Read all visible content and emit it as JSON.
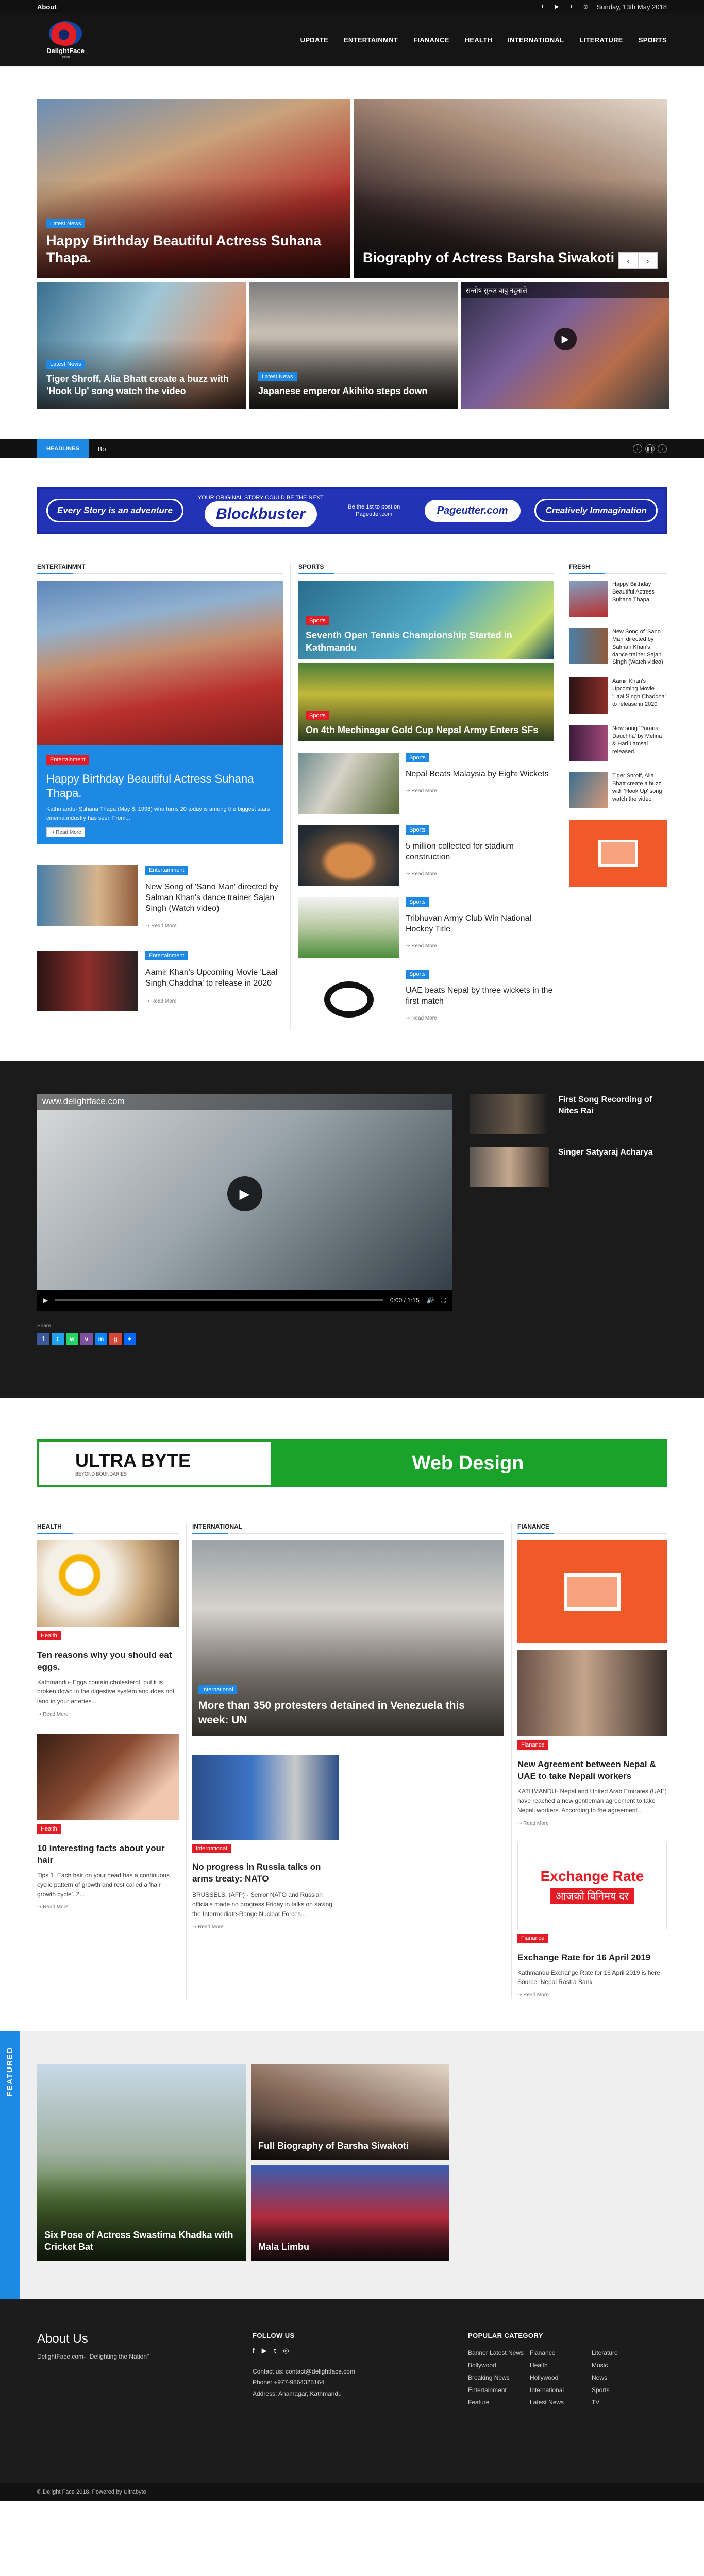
{
  "topbar": {
    "about": "About",
    "date": "Sunday, 13th May 2018"
  },
  "header": {
    "logo_text": "DelightFace",
    "logo_sub": ".com",
    "nav": [
      "UPDATE",
      "ENTERTAINMNT",
      "FIANANCE",
      "HEALTH",
      "INTERNATIONAL",
      "LITERATURE",
      "SPORTS"
    ]
  },
  "hero": {
    "main_left": {
      "badge": "Latest News",
      "title": "Happy Birthday Beautiful Actress Suhana Thapa."
    },
    "main_right": {
      "title": "Biography of Actress Barsha Siwakoti"
    },
    "pager": {
      "prev": "‹",
      "next": "›"
    },
    "small": [
      {
        "badge": "Latest News",
        "title": "Tiger Shroff, Alia Bhatt create a buzz with 'Hook Up' song watch the video"
      },
      {
        "badge": "Latest News",
        "title": "Japanese emperor Akihito steps down"
      },
      {
        "video_title": "सन्तोष सुन्दर बाबु नहुनाले"
      }
    ]
  },
  "ticker": {
    "label": "HEADLINES",
    "text": "Bo",
    "controls": [
      "‹",
      "❚❚",
      "›"
    ]
  },
  "banner1": {
    "left": "Every Story is an adventure",
    "center_small": "YOUR ORIGINAL STORY COULD BE THE NEXT",
    "center": "Blockbuster",
    "be_first": "Be the 1st to post on Pageutter.com",
    "brand": "Pageutter.com",
    "right": "Creatively Immagination"
  },
  "entertainment": {
    "head": "ENTERTAINMNT",
    "feature": {
      "badge": "Entertainment",
      "title": "Happy Birthday Beautiful Actress Suhana Thapa.",
      "excerpt": "Kathmandu- Suhana Thapa (May 8, 1998) who turns 20 today is among the biggest stars cinema industry has seen From...",
      "readmore": "Read More"
    },
    "items": [
      {
        "badge": "Entertainment",
        "title": "New Song of 'Sano Man' directed by Salman Khan's dance trainer Sajan Singh (Watch video)",
        "readmore": "Read More"
      },
      {
        "badge": "Entertainment",
        "title": "Aamir Khan's Upcoming Movie 'Laal Singh Chaddha' to release in 2020",
        "readmore": "Read More"
      }
    ]
  },
  "sports": {
    "head": "SPORTS",
    "big": [
      {
        "badge": "Sports",
        "title": "Seventh Open Tennis Championship Started in Kathmandu"
      },
      {
        "badge": "Sports",
        "title": "On 4th Mechinagar Gold Cup Nepal Army Enters SFs"
      }
    ],
    "items": [
      {
        "badge": "Sports",
        "title": "Nepal Beats Malaysia by Eight Wickets",
        "readmore": "Read More"
      },
      {
        "badge": "Sports",
        "title": "5 million collected for stadium construction",
        "readmore": "Read More"
      },
      {
        "badge": "Sports",
        "title": "Tribhuvan Army Club Win National Hockey Title",
        "readmore": "Read More"
      },
      {
        "badge": "Sports",
        "title": "UAE beats Nepal by three wickets in the first match",
        "readmore": "Read More"
      }
    ]
  },
  "fresh": {
    "head": "FRESH",
    "items": [
      {
        "title": "Happy Birthday Beautiful Actress Suhana Thapa."
      },
      {
        "title": "New Song of 'Sano Man' directed by Salman Khan's dance trainer Sajan Singh (Watch video)"
      },
      {
        "title": "Aamir Khan's Upcoming Movie 'Laal Singh Chaddha' to release in 2020"
      },
      {
        "title": "New song 'Parana Dauchha' by Melina & Hari Lamsal released."
      },
      {
        "title": "Tiger Shroff, Alia Bhatt create a buzz with 'Hook Up' song watch the video"
      }
    ]
  },
  "video": {
    "player_title": "www.delightface.com",
    "time": "0:00 / 1:15",
    "share_label": "Share",
    "share_icons": [
      "f",
      "t",
      "w",
      "v",
      "m",
      "g",
      "+"
    ],
    "side": [
      {
        "title": "First Song Recording of Nites Rai"
      },
      {
        "title": "Singer Satyaraj Acharya"
      }
    ]
  },
  "banner2": {
    "brand": "ULTRA BYTE",
    "tagline": "BEYOND BOUNDARIES",
    "service": "Web Design"
  },
  "health": {
    "head": "HEALTH",
    "items": [
      {
        "badge": "Health",
        "title": "Ten reasons why you should eat eggs.",
        "excerpt": "Kathmandu- Eggs contain cholesterol, but it is broken down in the digestive system and does not land in your arteries...",
        "readmore": "Read More"
      },
      {
        "badge": "Health",
        "title": "10 interesting facts about your hair",
        "excerpt": "Tips 1. Each hair on your head has a continuous cyclic pattern of growth and rest called a 'hair growth cycle'. 2...",
        "readmore": "Read More"
      }
    ]
  },
  "international": {
    "head": "INTERNATIONAL",
    "big": {
      "badge": "International",
      "title": "More than 350 protesters detained in Venezuela this week: UN"
    },
    "small": {
      "badge": "International",
      "title": "No progress in Russia talks on arms treaty: NATO",
      "excerpt": "BRUSSELS, (AFP) - Senior NATO and Russian officials made no progress Friday in talks on saving the Intermediate-Range Nuclear Forces...",
      "readmore": "Read More"
    }
  },
  "finance": {
    "head": "FIANANCE",
    "items": [
      {
        "badge": "Fianance",
        "title": "New Agreement between Nepal & UAE to take Nepali workers",
        "excerpt": "KATHMANDU- Nepal and United Arab Emirates (UAE) have reached a new gentleman agreement to take Nepali workers. According to the agreement...",
        "readmore": "Read More"
      },
      {
        "badge": "Fianance",
        "title": "Exchange Rate for 16 April 2019",
        "excerpt": "Kathmandu Exchange Rate for 16 April 2019 is here. Source: Nepal Rastra Bank",
        "readmore": "Read More",
        "image_title": "Exchange Rate",
        "image_sub": "आजको विनिमय दर"
      }
    ]
  },
  "featured": {
    "tab": "FEATURED",
    "items": [
      {
        "title": "Six Pose of Actress Swastima Khadka with Cricket Bat"
      },
      {
        "title": "Full Biography of Barsha Siwakoti"
      },
      {
        "title": "Mala Limbu"
      }
    ]
  },
  "footer": {
    "about_head": "About Us",
    "about_text": "DelightFace.com- \"Delighting the Nation\"",
    "follow_head": "FOLLOW US",
    "social": [
      "f",
      "▶",
      "t",
      "◎"
    ],
    "contact": "Contact us: contact@delightface.com",
    "phone": "Phone: +977-9864325164",
    "address": "Address: Anamagar, Kathmandu",
    "cat_head": "POPULAR CATEGORY",
    "categories": [
      "Banner Latest News",
      "Fianance",
      "Literature",
      "Bollywood",
      "Health",
      "Music",
      "Breaking News",
      "Hollywood",
      "News",
      "Entertainment",
      "International",
      "Sports",
      "Feature",
      "Latest News",
      "TV"
    ],
    "copyright": "© Delight Face 2018. Powered by Ultrabyte"
  },
  "colors": {
    "accent": "#1e88e5",
    "red": "#e31d25",
    "dark": "#151515"
  }
}
